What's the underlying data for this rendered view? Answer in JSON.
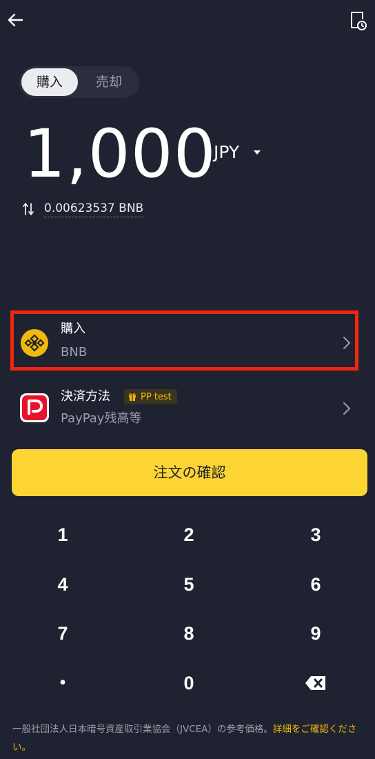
{
  "header": {
    "back_icon": "arrow-left-icon",
    "history_icon": "document-clock-icon"
  },
  "tabs": [
    {
      "label": "購入",
      "active": true
    },
    {
      "label": "売却",
      "active": false
    }
  ],
  "amount": {
    "value": "1,000",
    "currency": "JPY"
  },
  "conversion": {
    "text": "0.00623537 BNB"
  },
  "buy_row": {
    "title": "購入",
    "subtitle": "BNB",
    "icon": "bnb-coin-icon"
  },
  "payment_row": {
    "title": "決済方法",
    "badge": "PP test",
    "subtitle": "PayPay残高等",
    "icon": "paypay-logo-icon"
  },
  "confirm_button": {
    "label": "注文の確認"
  },
  "keypad": {
    "keys": [
      "1",
      "2",
      "3",
      "4",
      "5",
      "6",
      "7",
      "8",
      "9",
      "・",
      "0"
    ],
    "delete_icon": "backspace-icon"
  },
  "disclaimer": {
    "text": "一般社団法人日本暗号資産取引業協会（JVCEA）の参考価格。",
    "link": "詳細をご確認ください。"
  },
  "colors": {
    "background": "#1f2230",
    "accent": "#fcd535",
    "highlight_border": "#f0270f"
  }
}
